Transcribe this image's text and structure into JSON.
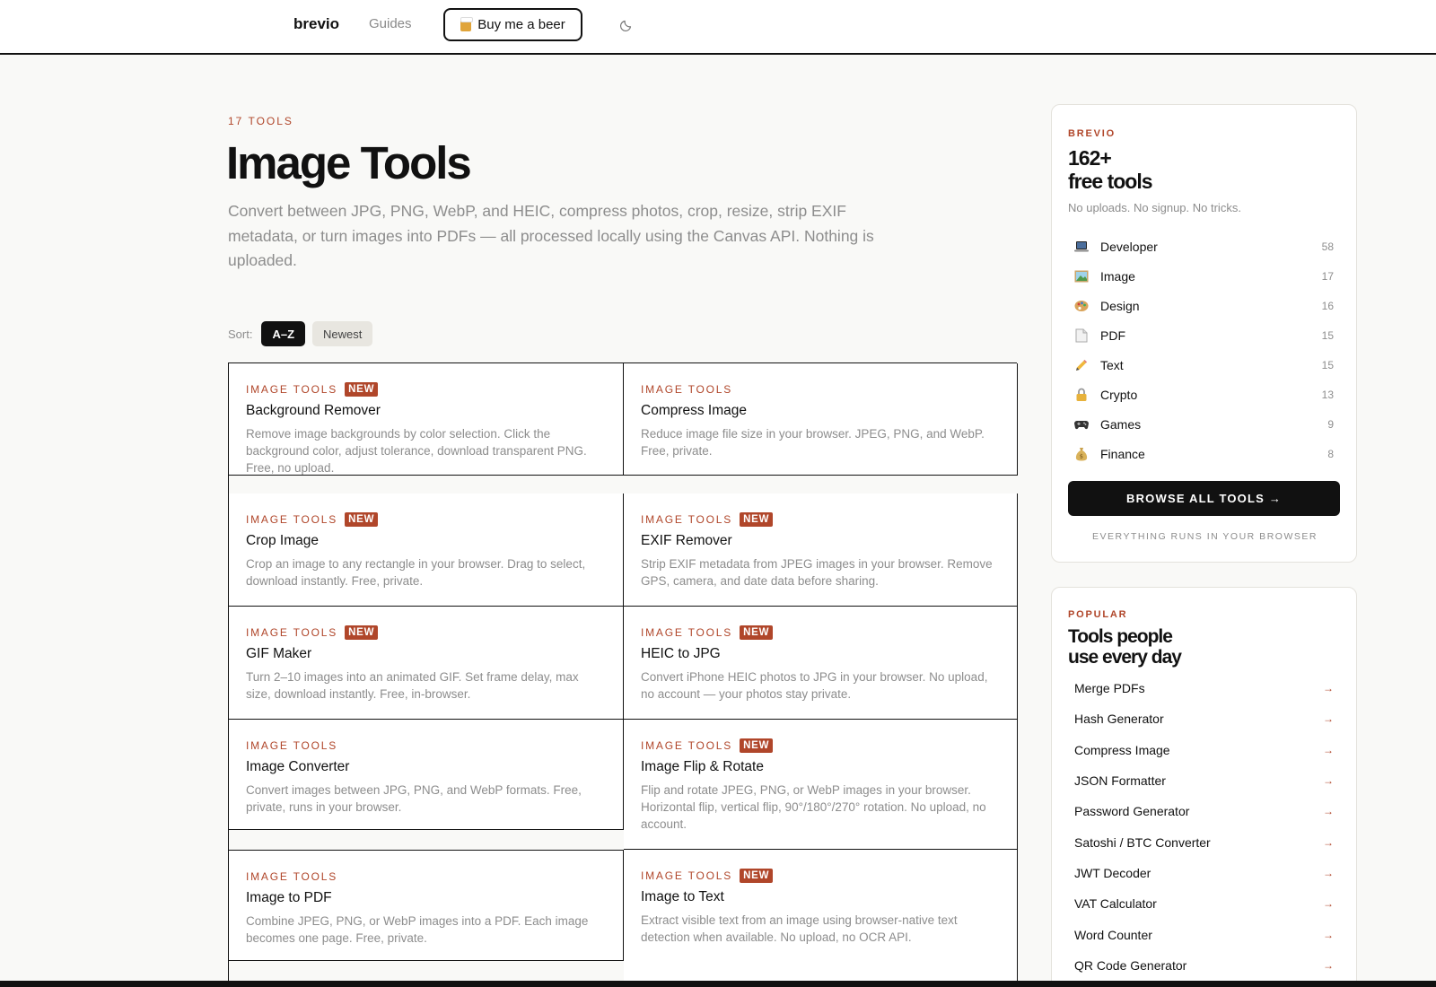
{
  "header": {
    "brand": "brevio",
    "nav_guides": "Guides",
    "beer_label": "Buy me a beer",
    "beer_icon": "beer-mug-icon",
    "theme_icon": "moon-icon"
  },
  "hero": {
    "eyebrow": "17 TOOLS",
    "title": "Image Tools",
    "description": "Convert between JPG, PNG, WebP, and HEIC, compress photos, crop, resize, strip EXIF metadata, or turn images into PDFs — all processed locally using the Canvas API. Nothing is uploaded."
  },
  "sort": {
    "label": "Sort:",
    "options": [
      "A–Z",
      "Newest"
    ],
    "active": "A–Z"
  },
  "tools": [
    {
      "category": "IMAGE TOOLS",
      "badge": "NEW",
      "title": "Background Remover",
      "description": "Remove image backgrounds by color selection. Click the background color, adjust tolerance, download transparent PNG. Free, no upload."
    },
    {
      "category": "IMAGE TOOLS",
      "badge": "",
      "title": "Compress Image",
      "description": "Reduce image file size in your browser. JPEG, PNG, and WebP. Free, private."
    },
    {
      "category": "IMAGE TOOLS",
      "badge": "NEW",
      "title": "Crop Image",
      "description": "Crop an image to any rectangle in your browser. Drag to select, download instantly. Free, private."
    },
    {
      "category": "IMAGE TOOLS",
      "badge": "NEW",
      "title": "EXIF Remover",
      "description": "Strip EXIF metadata from JPEG images in your browser. Remove GPS, camera, and date data before sharing."
    },
    {
      "category": "IMAGE TOOLS",
      "badge": "NEW",
      "title": "GIF Maker",
      "description": "Turn 2–10 images into an animated GIF. Set frame delay, max size, download instantly. Free, in-browser."
    },
    {
      "category": "IMAGE TOOLS",
      "badge": "NEW",
      "title": "HEIC to JPG",
      "description": "Convert iPhone HEIC photos to JPG in your browser. No upload, no account — your photos stay private."
    },
    {
      "category": "IMAGE TOOLS",
      "badge": "",
      "title": "Image Converter",
      "description": "Convert images between JPG, PNG, and WebP formats. Free, private, runs in your browser."
    },
    {
      "category": "IMAGE TOOLS",
      "badge": "NEW",
      "title": "Image Flip & Rotate",
      "description": "Flip and rotate JPEG, PNG, or WebP images in your browser. Horizontal flip, vertical flip, 90°/180°/270° rotation. No upload, no account."
    },
    {
      "category": "IMAGE TOOLS",
      "badge": "",
      "title": "Image to PDF",
      "description": "Combine JPEG, PNG, or WebP images into a PDF. Each image becomes one page. Free, private."
    },
    {
      "category": "IMAGE TOOLS",
      "badge": "NEW",
      "title": "Image to Text",
      "description": "Extract visible text from an image using browser-native text detection when available. No upload, no OCR API."
    }
  ],
  "sidebar": {
    "eyebrow": "BREVIO",
    "headline_1": "162+",
    "headline_2": "free tools",
    "subtitle": "No uploads. No signup. No tricks.",
    "categories": [
      {
        "icon": "laptop-icon",
        "name": "Developer",
        "count": "58"
      },
      {
        "icon": "picture-icon",
        "name": "Image",
        "count": "17"
      },
      {
        "icon": "palette-icon",
        "name": "Design",
        "count": "16"
      },
      {
        "icon": "document-icon",
        "name": "PDF",
        "count": "15"
      },
      {
        "icon": "pencil-icon",
        "name": "Text",
        "count": "15"
      },
      {
        "icon": "lock-icon",
        "name": "Crypto",
        "count": "13"
      },
      {
        "icon": "gamepad-icon",
        "name": "Games",
        "count": "9"
      },
      {
        "icon": "money-bag-icon",
        "name": "Finance",
        "count": "8"
      }
    ],
    "browse_label": "BROWSE ALL TOOLS →",
    "footnote": "EVERYTHING RUNS IN YOUR BROWSER"
  },
  "popular": {
    "eyebrow": "POPULAR",
    "headline_1": "Tools people",
    "headline_2": "use every day",
    "items": [
      "Merge PDFs",
      "Hash Generator",
      "Compress Image",
      "JSON Formatter",
      "Password Generator",
      "Satoshi / BTC Converter",
      "JWT Decoder",
      "VAT Calculator",
      "Word Counter",
      "QR Code Generator"
    ],
    "arrow": "→"
  },
  "colors": {
    "accent": "#b0462a",
    "ink": "#111111",
    "muted": "#8d8d8d",
    "background": "#f9f9f7"
  }
}
